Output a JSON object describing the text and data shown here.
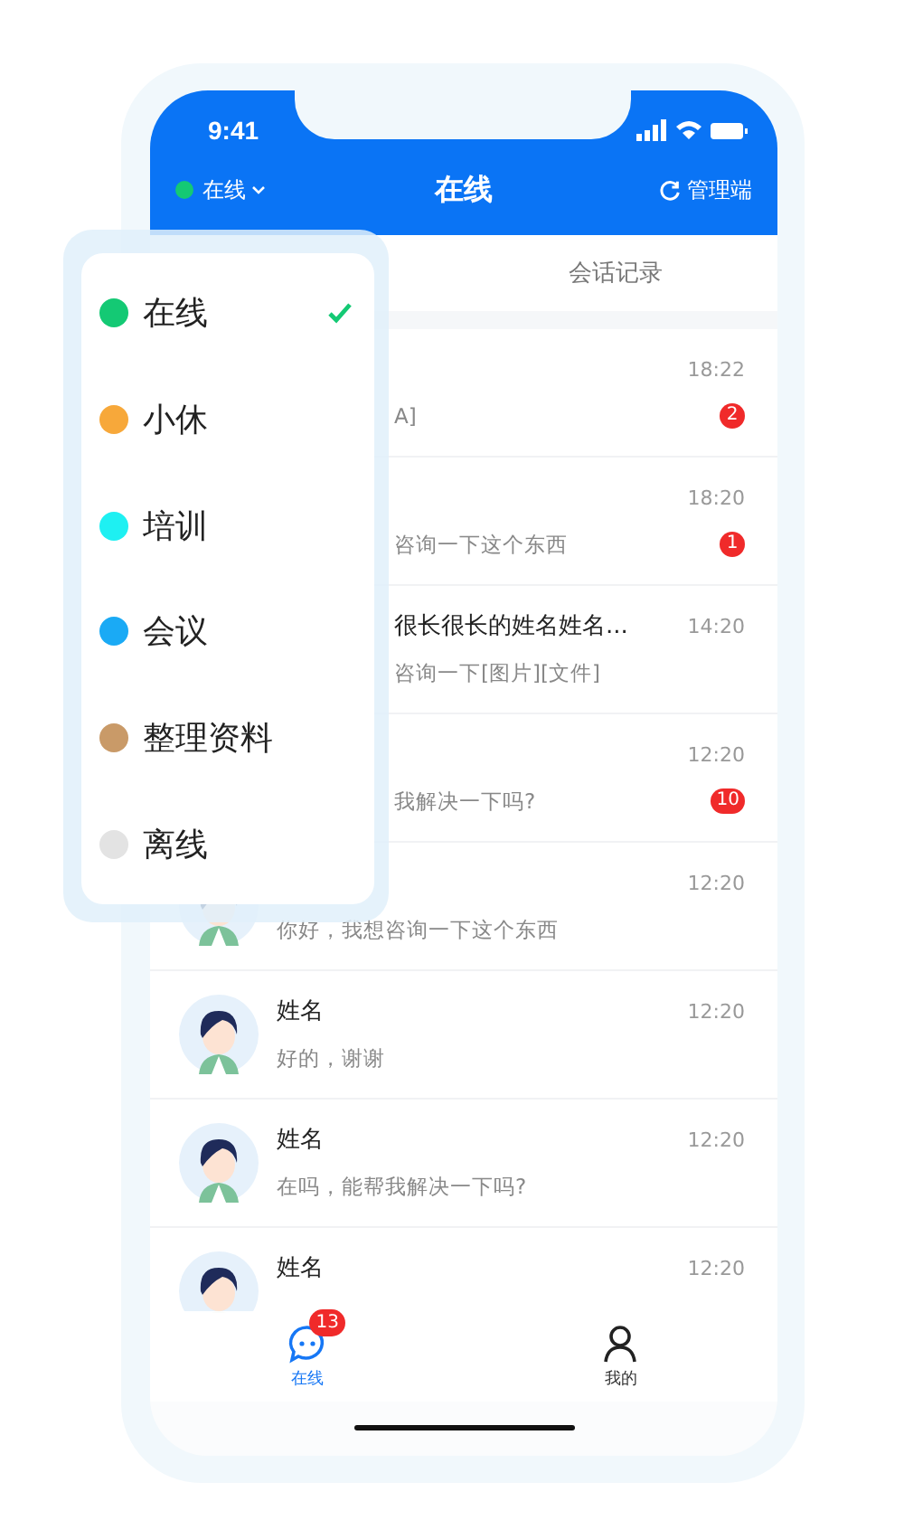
{
  "status_bar": {
    "time": "9:41"
  },
  "nav_bar": {
    "status_label": "在线",
    "title": "在线",
    "admin_label": "管理端"
  },
  "tabs": [
    {
      "label": "会话记录",
      "selected": false
    }
  ],
  "conversations": [
    {
      "kind": "covered",
      "preview": "A]",
      "time": "18:22",
      "badge": "2"
    },
    {
      "kind": "covered",
      "preview": "咨询一下这个东西",
      "time": "18:20",
      "badge": "1"
    },
    {
      "kind": "covered",
      "name": "很长很长的姓名姓名...",
      "preview": "咨询一下[图片][文件]",
      "time": "14:20"
    },
    {
      "kind": "covered",
      "preview": "我解决一下吗?",
      "time": "12:20",
      "badge": "10"
    },
    {
      "kind": "full",
      "preview": "你好，我想咨询一下这个东西",
      "time": "12:20"
    },
    {
      "kind": "full",
      "name": "姓名",
      "preview": "好的，谢谢",
      "time": "12:20"
    },
    {
      "kind": "full",
      "name": "姓名",
      "preview": "在吗，能帮我解决一下吗?",
      "time": "12:20"
    },
    {
      "kind": "full",
      "name": "姓名",
      "time": "12:20"
    }
  ],
  "status_menu": [
    {
      "label": "在线",
      "color": "#14c974",
      "selected": true
    },
    {
      "label": "小休",
      "color": "#f7a83a",
      "selected": false
    },
    {
      "label": "培训",
      "color": "#1ef0f2",
      "selected": false
    },
    {
      "label": "会议",
      "color": "#1aaaf5",
      "selected": false
    },
    {
      "label": "整理资料",
      "color": "#c99a68",
      "selected": false
    },
    {
      "label": "离线",
      "color": "#e3e3e3",
      "selected": false
    }
  ],
  "bottom_tabs": [
    {
      "kind": "chat",
      "label": "在线",
      "selected": true,
      "badge": "13"
    },
    {
      "kind": "person",
      "label": "我的",
      "selected": false
    }
  ]
}
